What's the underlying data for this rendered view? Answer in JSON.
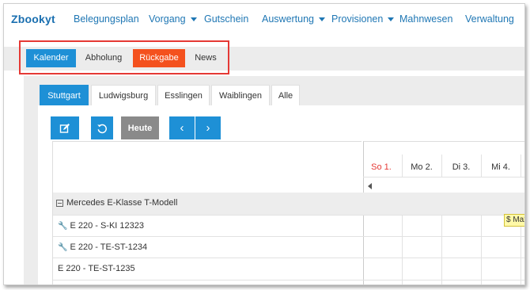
{
  "app": {
    "logo_text": "bookyt"
  },
  "nav": {
    "items": [
      {
        "label": "Belegungsplan",
        "has_caret": false
      },
      {
        "label": "Vorgang",
        "has_caret": true
      },
      {
        "label": "Gutschein",
        "has_caret": false
      },
      {
        "label": "Auswertung",
        "has_caret": true
      },
      {
        "label": "Provisionen",
        "has_caret": true
      },
      {
        "label": "Mahnwesen",
        "has_caret": false
      },
      {
        "label": "Verwaltung",
        "has_caret": false
      }
    ]
  },
  "views": {
    "items": [
      {
        "label": "Kalender",
        "state": "active"
      },
      {
        "label": "Abholung",
        "state": "normal"
      },
      {
        "label": "Rückgabe",
        "state": "highlight"
      },
      {
        "label": "News",
        "state": "normal"
      }
    ]
  },
  "locations": {
    "items": [
      {
        "label": "Stuttgart",
        "active": true
      },
      {
        "label": "Ludwigsburg",
        "active": false
      },
      {
        "label": "Esslingen",
        "active": false
      },
      {
        "label": "Waiblingen",
        "active": false
      },
      {
        "label": "Alle",
        "active": false
      }
    ]
  },
  "toolbar": {
    "edit_icon": "edit-icon",
    "refresh_icon": "refresh-icon",
    "today_label": "Heute",
    "prev_label": "‹",
    "next_label": "›"
  },
  "calendar": {
    "days": [
      {
        "label": "So 1.",
        "weekend": true
      },
      {
        "label": "Mo 2.",
        "weekend": false
      },
      {
        "label": "Di 3.",
        "weekend": false
      },
      {
        "label": "Mi 4.",
        "weekend": false
      }
    ],
    "group": {
      "label": "Mercedes E-Klasse T-Modell"
    },
    "vehicles": [
      {
        "label": "E 220 - S-KI 12323",
        "service": true
      },
      {
        "label": "E 220 - TE-ST-1234",
        "service": true
      },
      {
        "label": "E 220 - TE-ST-1235",
        "service": false
      }
    ],
    "booking": {
      "label": "$ Max M"
    }
  },
  "colors": {
    "primary": "#1e90d6",
    "accent": "#f4511e",
    "highlight_border": "#e53935",
    "sunday": "#e53935",
    "booking_bg": "#fff9a8"
  }
}
